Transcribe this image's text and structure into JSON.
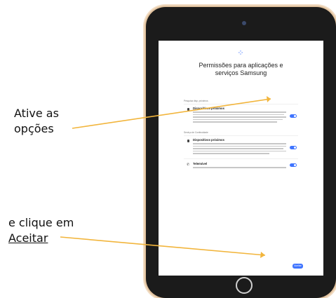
{
  "annotations": {
    "enable_line1": "Ative as",
    "enable_line2": "opções",
    "click_line1": "e clique em",
    "click_link": "Aceitar"
  },
  "screen": {
    "title_line1": "Permissões para aplicações e",
    "title_line2": "serviços Samsung",
    "sections": [
      {
        "label": "Pesquisa disp. próximos"
      },
      {
        "label": "Serviço de Continuidade"
      }
    ],
    "items": [
      {
        "title": "Dispositivos próximos",
        "icon": "device-icon",
        "enabled": true
      },
      {
        "title": "Dispositivos próximos",
        "icon": "device-icon",
        "enabled": true
      },
      {
        "title": "Telemóvel",
        "icon": "phone-icon",
        "enabled": true
      }
    ],
    "accept_label": "Aceitar"
  },
  "colors": {
    "accent": "#3f74ff",
    "arrow": "#f2b53c",
    "tablet_frame": "#e1c29e"
  }
}
